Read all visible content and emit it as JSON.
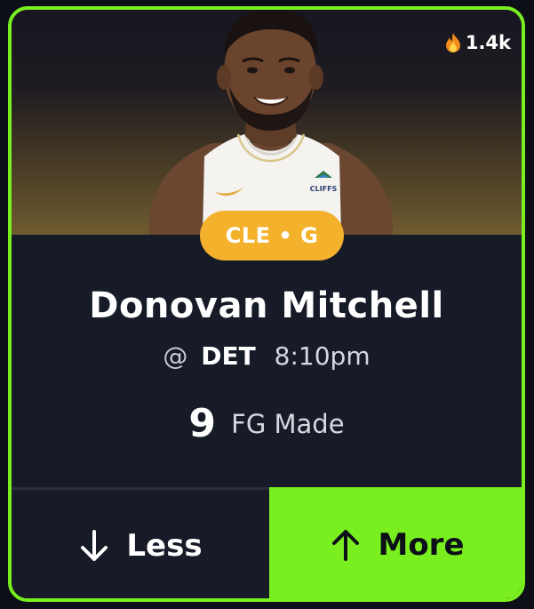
{
  "card": {
    "popularity": "1.4k",
    "popularity_icon": "fire-icon",
    "team_badge": "CLE • G",
    "player_name": "Donovan Mitchell",
    "matchup": {
      "at_symbol": "@",
      "opponent": "DET",
      "time": "8:10pm"
    },
    "stat": {
      "value": "9",
      "label": "FG Made"
    },
    "jersey_text": "CLIFFS"
  },
  "actions": {
    "less_label": "Less",
    "less_icon": "arrow-down-icon",
    "more_label": "More",
    "more_icon": "arrow-up-icon"
  },
  "colors": {
    "accent": "#79ef1f",
    "badge": "#f4b12c",
    "card_bg": "#171a27"
  }
}
